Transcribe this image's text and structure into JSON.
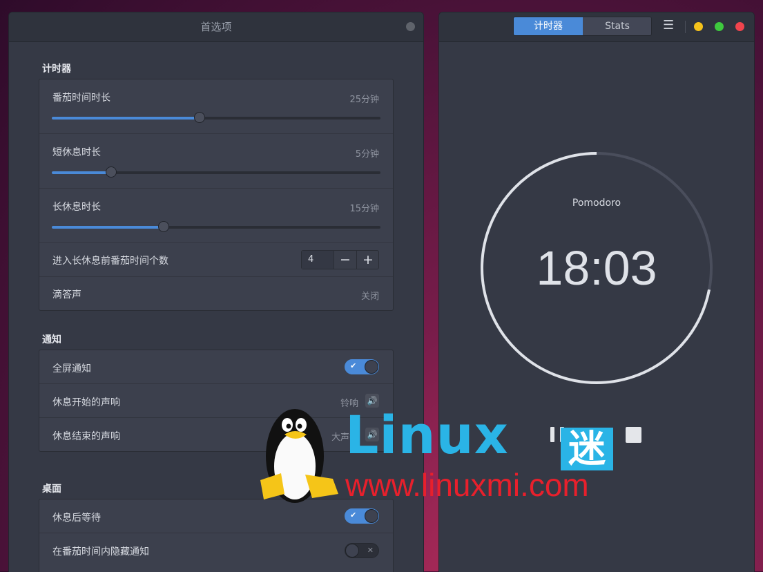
{
  "colors": {
    "accent": "#4a8ad8",
    "panel": "#353945",
    "header": "#2f333d",
    "yellow": "#f5c21b",
    "green": "#3ec93e",
    "red": "#f0444d"
  },
  "prefs": {
    "title": "首选项",
    "timer_section": {
      "title": "计时器",
      "pomodoro": {
        "label": "番茄时间时长",
        "value": "25分钟",
        "level": 0.45
      },
      "short_break": {
        "label": "短休息时长",
        "value": "5分钟",
        "level": 0.18
      },
      "long_break": {
        "label": "长休息时长",
        "value": "15分钟",
        "level": 0.34
      },
      "count": {
        "label": "进入长休息前番茄时间个数",
        "value": "4",
        "minus": "−",
        "plus": "+"
      },
      "tick": {
        "label": "滴答声",
        "value": "关闭"
      }
    },
    "notify_section": {
      "title": "通知",
      "fullscreen": {
        "label": "全屏通知",
        "on": true
      },
      "break_start": {
        "label": "休息开始的声响",
        "value": "铃响"
      },
      "break_end": {
        "label": "休息结束的声响",
        "value": "大声铃"
      }
    },
    "desktop_section": {
      "title": "桌面",
      "wait_after_break": {
        "label": "休息后等待",
        "on": true
      },
      "hide_notify": {
        "label": "在番茄时间内隐藏通知",
        "on": false
      }
    }
  },
  "timer": {
    "tabs": [
      "计时器",
      "Stats"
    ],
    "active_tab": 0,
    "state_label": "Pomodoro",
    "time": "18:03",
    "progress": 0.28,
    "menu_icon": "hamburger-menu-icon"
  },
  "watermark": {
    "brand": "Linux",
    "brand_cn": "迷",
    "url": "www.linuxmi.com"
  }
}
